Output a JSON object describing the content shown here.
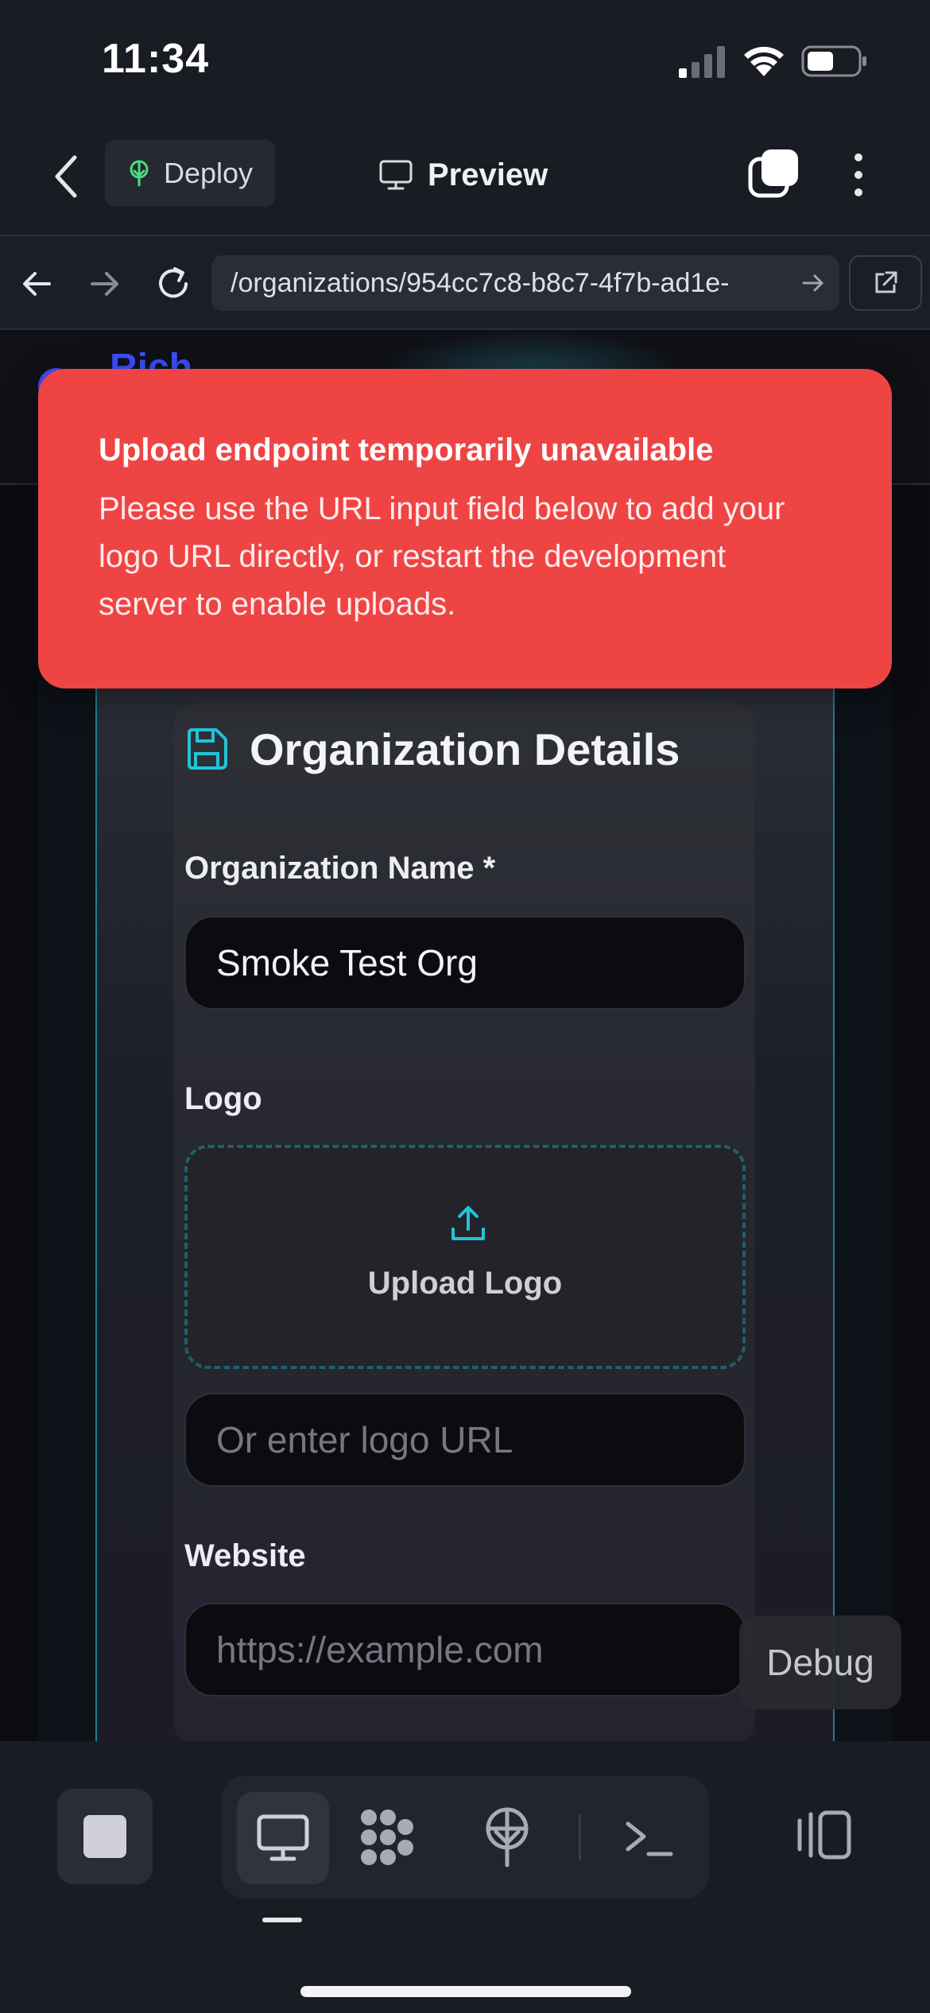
{
  "status_bar": {
    "time": "11:34"
  },
  "header": {
    "deploy_label": "Deploy",
    "title": "Preview"
  },
  "browser": {
    "url": "/organizations/954cc7c8-b8c7-4f7b-ad1e-"
  },
  "site": {
    "brand": "Rich"
  },
  "toast": {
    "title": "Upload endpoint temporarily unavailable",
    "message": "Please use the URL input field below to add your logo URL directly, or restart the development server to enable uploads."
  },
  "form": {
    "section_title": "Organization Details",
    "name_label": "Organization Name *",
    "name_value": "Smoke Test Org",
    "logo_label": "Logo",
    "upload_label": "Upload Logo",
    "logo_url_placeholder": "Or enter logo URL",
    "website_label": "Website",
    "website_placeholder": "https://example.com"
  },
  "debug_label": "Debug",
  "colors": {
    "toast_bg": "#ef4444",
    "accent_cyan": "#22c3d8",
    "brand_blue": "#3b4fff",
    "deploy_icon_green": "#4ade80"
  },
  "icons": {
    "signal": "cellular-signal-icon",
    "wifi": "wifi-icon",
    "battery": "battery-icon",
    "back": "chevron-left-icon",
    "deploy": "deploy-tree-icon",
    "preview": "monitor-icon",
    "tabs": "tabs-icon",
    "more": "more-vertical-icon",
    "save": "save-icon",
    "upload": "upload-icon",
    "stop": "stop-icon",
    "nodes": "nodes-icon",
    "terminal": "terminal-icon",
    "panel": "panel-toggle-icon"
  }
}
